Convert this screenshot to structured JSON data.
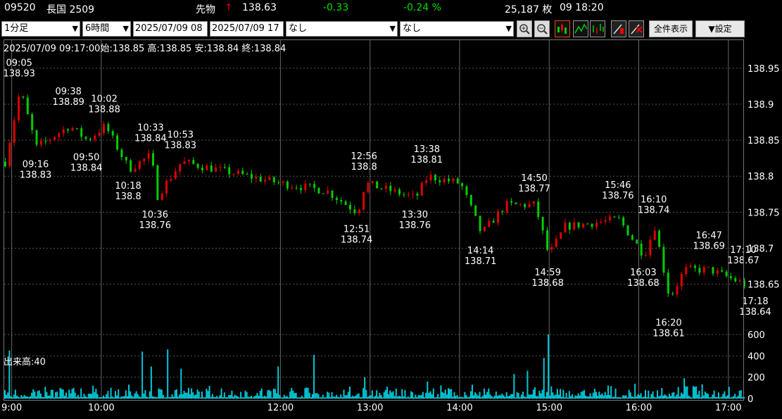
{
  "header": {
    "code": "09520",
    "name": "長国 2509",
    "type": "先物",
    "arrow": "↑",
    "price": "138.63",
    "change": "-0.33",
    "change_pct": "-0.24 %",
    "volume": "25,187 枚",
    "time": "09 18:20"
  },
  "toolbar": {
    "interval": "1分足",
    "span": "6時間",
    "from": "2025/07/09 08",
    "to": "2025/07/09 17",
    "indicator1": "なし",
    "indicator2": "なし",
    "fullview_label": "全件表示",
    "settings_label": "▼設定"
  },
  "colors": {
    "up": "#e00000",
    "down": "#00cc00",
    "volume": "#00c8d8",
    "grid": "#555555"
  },
  "info": {
    "line": "2025/07/09 09:17:00始:138.85 高:138.85 安:138.84 終:138.84",
    "volume_label": "出来高:40"
  },
  "chart_data": {
    "type": "candlestick",
    "y_ticks": [
      "138.95",
      "138.9",
      "138.85",
      "138.8",
      "138.75",
      "138.7",
      "138.65"
    ],
    "ylim": [
      138.585,
      138.99
    ],
    "vol_ticks": [
      "600",
      "400",
      "200",
      "0"
    ],
    "vol_lim": [
      0,
      600
    ],
    "time_range": [
      "08:55",
      "17:10"
    ],
    "x_ticks": [
      {
        "time": "09:00",
        "label": "9:00"
      },
      {
        "time": "10:00",
        "label": "10:00"
      },
      {
        "time": "12:00",
        "label": "12:00"
      },
      {
        "time": "13:00",
        "label": "13:00"
      },
      {
        "time": "14:00",
        "label": "14:00"
      },
      {
        "time": "15:00",
        "label": "15:00"
      },
      {
        "time": "16:00",
        "label": "16:00"
      },
      {
        "time": "17:00",
        "label": "17:00"
      }
    ],
    "annotations": [
      {
        "time": "09:05",
        "price": 138.93,
        "pos": "above"
      },
      {
        "time": "09:16",
        "price": 138.83,
        "pos": "below"
      },
      {
        "time": "09:38",
        "price": 138.89,
        "pos": "above"
      },
      {
        "time": "09:50",
        "price": 138.84,
        "pos": "below"
      },
      {
        "time": "10:02",
        "price": 138.88,
        "pos": "above"
      },
      {
        "time": "10:18",
        "price": 138.8,
        "pos": "below"
      },
      {
        "time": "10:33",
        "price": 138.84,
        "pos": "above"
      },
      {
        "time": "10:36",
        "price": 138.76,
        "pos": "below"
      },
      {
        "time": "10:53",
        "price": 138.83,
        "pos": "above"
      },
      {
        "time": "12:51",
        "price": 138.74,
        "pos": "below"
      },
      {
        "time": "12:56",
        "price": 138.8,
        "pos": "above"
      },
      {
        "time": "13:30",
        "price": 138.76,
        "pos": "below"
      },
      {
        "time": "13:38",
        "price": 138.81,
        "pos": "above"
      },
      {
        "time": "14:14",
        "price": 138.71,
        "pos": "below"
      },
      {
        "time": "14:50",
        "price": 138.77,
        "pos": "above"
      },
      {
        "time": "14:59",
        "price": 138.68,
        "pos": "below"
      },
      {
        "time": "15:46",
        "price": 138.76,
        "pos": "above"
      },
      {
        "time": "16:03",
        "price": 138.68,
        "pos": "below"
      },
      {
        "time": "16:10",
        "price": 138.74,
        "pos": "above"
      },
      {
        "time": "16:20",
        "price": 138.61,
        "pos": "below"
      },
      {
        "time": "16:47",
        "price": 138.69,
        "pos": "above"
      },
      {
        "time": "17:10",
        "price": 138.67,
        "pos": "above"
      },
      {
        "time": "17:18",
        "price": 138.64,
        "pos": "below"
      }
    ],
    "price_path": [
      [
        "08:55",
        138.82
      ],
      [
        "09:05",
        138.92
      ],
      [
        "09:16",
        138.84
      ],
      [
        "09:38",
        138.87
      ],
      [
        "09:50",
        138.85
      ],
      [
        "10:02",
        138.87
      ],
      [
        "10:18",
        138.81
      ],
      [
        "10:33",
        138.83
      ],
      [
        "10:36",
        138.77
      ],
      [
        "10:53",
        138.82
      ],
      [
        "12:00",
        138.79
      ],
      [
        "12:30",
        138.78
      ],
      [
        "12:51",
        138.75
      ],
      [
        "12:56",
        138.79
      ],
      [
        "13:30",
        138.77
      ],
      [
        "13:38",
        138.8
      ],
      [
        "14:00",
        138.79
      ],
      [
        "14:14",
        138.72
      ],
      [
        "14:30",
        138.76
      ],
      [
        "14:50",
        138.76
      ],
      [
        "14:59",
        138.69
      ],
      [
        "15:10",
        138.73
      ],
      [
        "15:46",
        138.74
      ],
      [
        "16:03",
        138.69
      ],
      [
        "16:10",
        138.73
      ],
      [
        "16:20",
        138.63
      ],
      [
        "16:30",
        138.67
      ],
      [
        "16:47",
        138.67
      ],
      [
        "17:10",
        138.65
      ]
    ],
    "volume_spikes": [
      [
        "08:58",
        450
      ],
      [
        "09:33",
        90
      ],
      [
        "09:40",
        90
      ],
      [
        "10:27",
        440
      ],
      [
        "10:33",
        300
      ],
      [
        "10:44",
        460
      ],
      [
        "10:53",
        280
      ],
      [
        "11:58",
        300
      ],
      [
        "12:22",
        410
      ],
      [
        "12:56",
        200
      ],
      [
        "13:38",
        160
      ],
      [
        "14:36",
        230
      ],
      [
        "14:45",
        260
      ],
      [
        "14:56",
        380
      ],
      [
        "14:59",
        600
      ],
      [
        "15:15",
        40
      ],
      [
        "16:15",
        100
      ],
      [
        "16:30",
        190
      ],
      [
        "16:37",
        110
      ],
      [
        "17:00",
        110
      ]
    ]
  }
}
